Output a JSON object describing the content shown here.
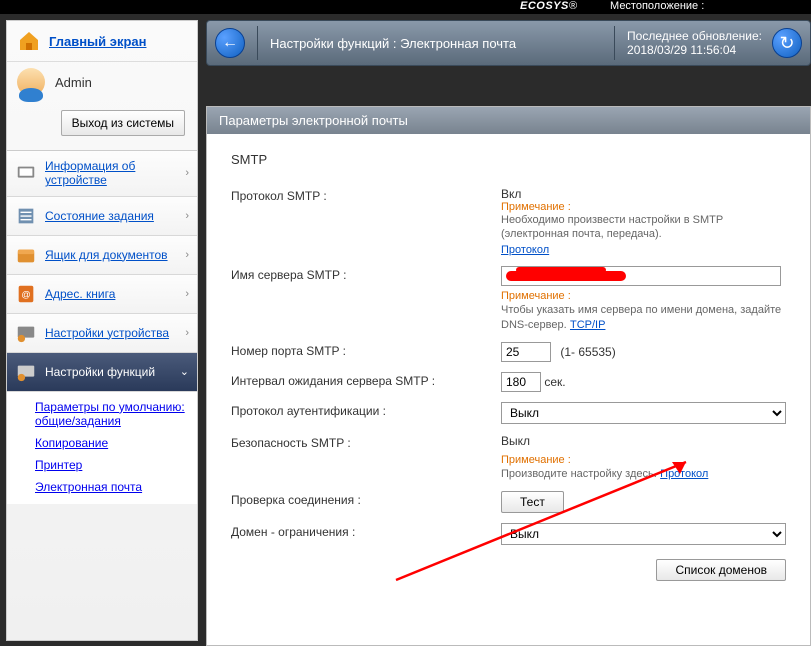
{
  "brand": "ECOSYS",
  "location_label": "Местоположение :",
  "sidebar": {
    "home": "Главный экран",
    "user": "Admin",
    "logout": "Выход из системы",
    "items": [
      {
        "label": "Информация об устройстве"
      },
      {
        "label": "Состояние задания"
      },
      {
        "label": "Ящик для документов"
      },
      {
        "label": "Адрес. книга"
      },
      {
        "label": "Настройки устройства"
      },
      {
        "label": "Настройки функций"
      }
    ],
    "sub": [
      "Параметры по умолчанию: общие/задания",
      "Копирование",
      "Принтер",
      "Электронная почта"
    ]
  },
  "header": {
    "breadcrumb": "Настройки функций : Электронная почта",
    "update_label": "Последнее обновление:",
    "update_time": "2018/03/29 11:56:04"
  },
  "panel": {
    "title": "Параметры электронной почты",
    "section": "SMTP",
    "rows": {
      "protocol_label": "Протокол SMTP :",
      "protocol_value": "Вкл",
      "protocol_note_label": "Примечание :",
      "protocol_note": "Необходимо произвести настройки в SMTP (электронная почта, передача).",
      "protocol_link": "Протокол",
      "server_label": "Имя сервера SMTP :",
      "server_value": "",
      "server_note_label": "Примечание :",
      "server_note": "Чтобы указать имя сервера по имени домена, задайте DNS-сервер.",
      "server_link": "TCP/IP",
      "port_label": "Номер порта SMTP :",
      "port_value": "25",
      "port_range": "(1- 65535)",
      "timeout_label": "Интервал ожидания сервера SMTP :",
      "timeout_value": "180",
      "timeout_unit": "сек.",
      "auth_label": "Протокол аутентификации :",
      "auth_value": "Выкл",
      "security_label": "Безопасность SMTP :",
      "security_value": "Выкл",
      "security_note_label": "Примечание :",
      "security_note": "Производите настройку здесь.",
      "security_link": "Протокол",
      "test_label": "Проверка соединения :",
      "test_button": "Тест",
      "domain_label": "Домен - ограничения :",
      "domain_value": "Выкл",
      "domain_list_button": "Список доменов"
    }
  }
}
